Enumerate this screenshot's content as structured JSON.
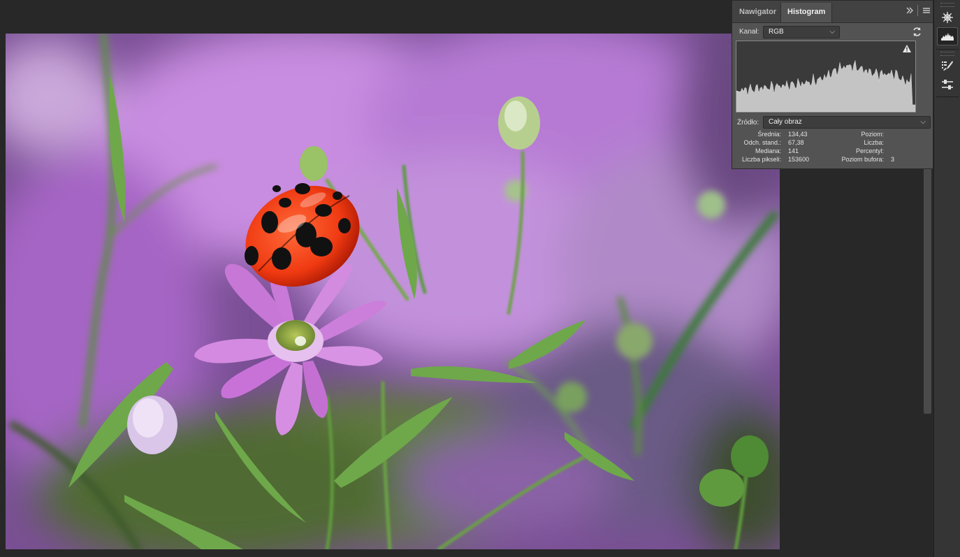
{
  "panel": {
    "tabs": [
      {
        "label": "Nawigator",
        "active": false
      },
      {
        "label": "Histogram",
        "active": true
      }
    ],
    "expand_icon": "double-chevron-right-icon",
    "menu_icon": "hamburger-menu-icon",
    "channel": {
      "label": "Kanał:",
      "value": "RGB"
    },
    "refresh_icon": "refresh-icon",
    "warning_icon": "warning-triangle-icon",
    "source": {
      "label": "Źródło:",
      "value": "Cały obraz"
    },
    "stats_left": [
      {
        "label": "Średnia:",
        "value": "134,43"
      },
      {
        "label": "Odch. stand.:",
        "value": "67,38"
      },
      {
        "label": "Mediana:",
        "value": "141"
      },
      {
        "label": "Liczba pikseli:",
        "value": "153600"
      }
    ],
    "stats_right": [
      {
        "label": "Poziom:",
        "value": ""
      },
      {
        "label": "Liczba:",
        "value": ""
      },
      {
        "label": "Percentyl:",
        "value": ""
      },
      {
        "label": "Poziom bufora:",
        "value": "3"
      }
    ]
  },
  "right_toolbar": [
    {
      "icon": "navigator-wheel-icon",
      "active": false
    },
    {
      "icon": "histogram-icon",
      "active": true
    },
    {
      "icon": "brush-presets-icon",
      "active": false
    },
    {
      "icon": "adjustments-sliders-icon",
      "active": false
    }
  ],
  "colors": {
    "background": "#282828",
    "panel": "#535353",
    "tab_bar": "#424242",
    "histogram_fill": "#c4c4c4"
  }
}
